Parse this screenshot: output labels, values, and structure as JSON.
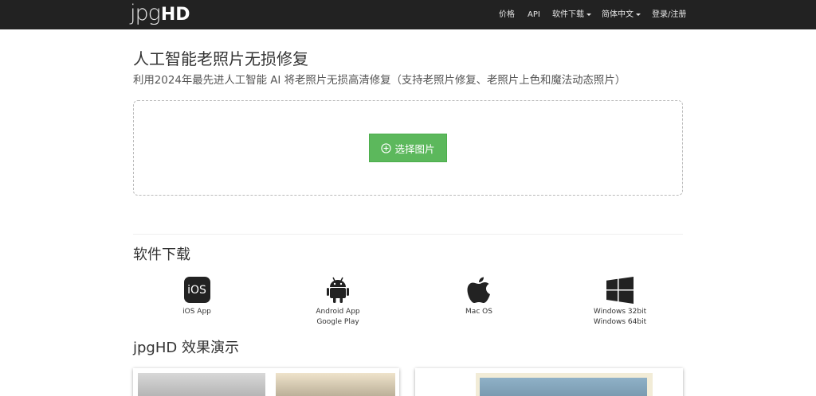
{
  "brand": {
    "logo_light": "jpg",
    "logo_bold": "HD"
  },
  "nav": {
    "price": "价格",
    "api": "API",
    "download": "软件下载",
    "language": "简体中文",
    "login": "登录/注册"
  },
  "hero": {
    "title": "人工智能老照片无损修复",
    "subtitle": "利用2024年最先进人工智能 AI 将老照片无损高清修复（支持老照片修复、老照片上色和魔法动态照片）",
    "select_button": "选择图片"
  },
  "downloads": {
    "title": "软件下载",
    "ios_icon_text": "iOS",
    "ios_label": "iOS App",
    "android_label_1": "Android App",
    "android_label_2": "Google Play",
    "mac_label": "Mac OS",
    "windows_label_1": "Windows 32bit",
    "windows_label_2": "Windows 64bit"
  },
  "demo": {
    "title": "jpgHD 效果演示"
  },
  "icons": {
    "plus": "circle-plus-icon",
    "android": "android-icon",
    "apple": "apple-icon",
    "windows": "windows-icon"
  },
  "colors": {
    "navbar": "#222222",
    "button": "#5cb85c"
  }
}
